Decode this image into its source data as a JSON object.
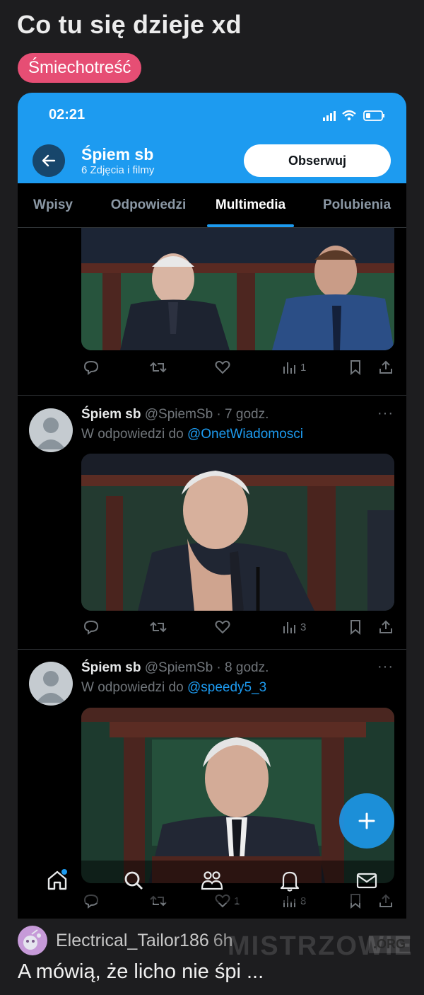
{
  "post": {
    "title": "Co tu się dzieje xd",
    "tag": "Śmiechotreść"
  },
  "phone": {
    "status_time": "02:21",
    "profile": {
      "name": "Śpiem sb",
      "subtitle": "6 Zdjęcia i filmy",
      "follow_label": "Obserwuj"
    },
    "tabs": [
      {
        "label": "Wpisy",
        "active": false
      },
      {
        "label": "Odpowiedzi",
        "active": false
      },
      {
        "label": "Multimedia",
        "active": true
      },
      {
        "label": "Polubienia",
        "active": false
      }
    ],
    "tweets": [
      {
        "views": "1"
      },
      {
        "name": "Śpiem sb",
        "meta": "@SpiemSb · 7 godz.",
        "reply_prefix": "W odpowiedzi do ",
        "mention": "@OnetWiadomosci",
        "views": "3"
      },
      {
        "name": "Śpiem sb",
        "meta": "@SpiemSb · 8 godz.",
        "reply_prefix": "W odpowiedzi do ",
        "mention": "@speedy5_3",
        "likes": "1",
        "views": "8"
      }
    ]
  },
  "comment": {
    "author": "Electrical_Tailor186",
    "time": "6h",
    "text": "A mówią, że licho nie śpi ..."
  },
  "watermark": {
    "text": "MISTRZOWIE",
    "suffix": ".ORG"
  },
  "colors": {
    "accent": "#1d9bf0",
    "tag": "#e64e74",
    "background": "#1d1d1f"
  }
}
